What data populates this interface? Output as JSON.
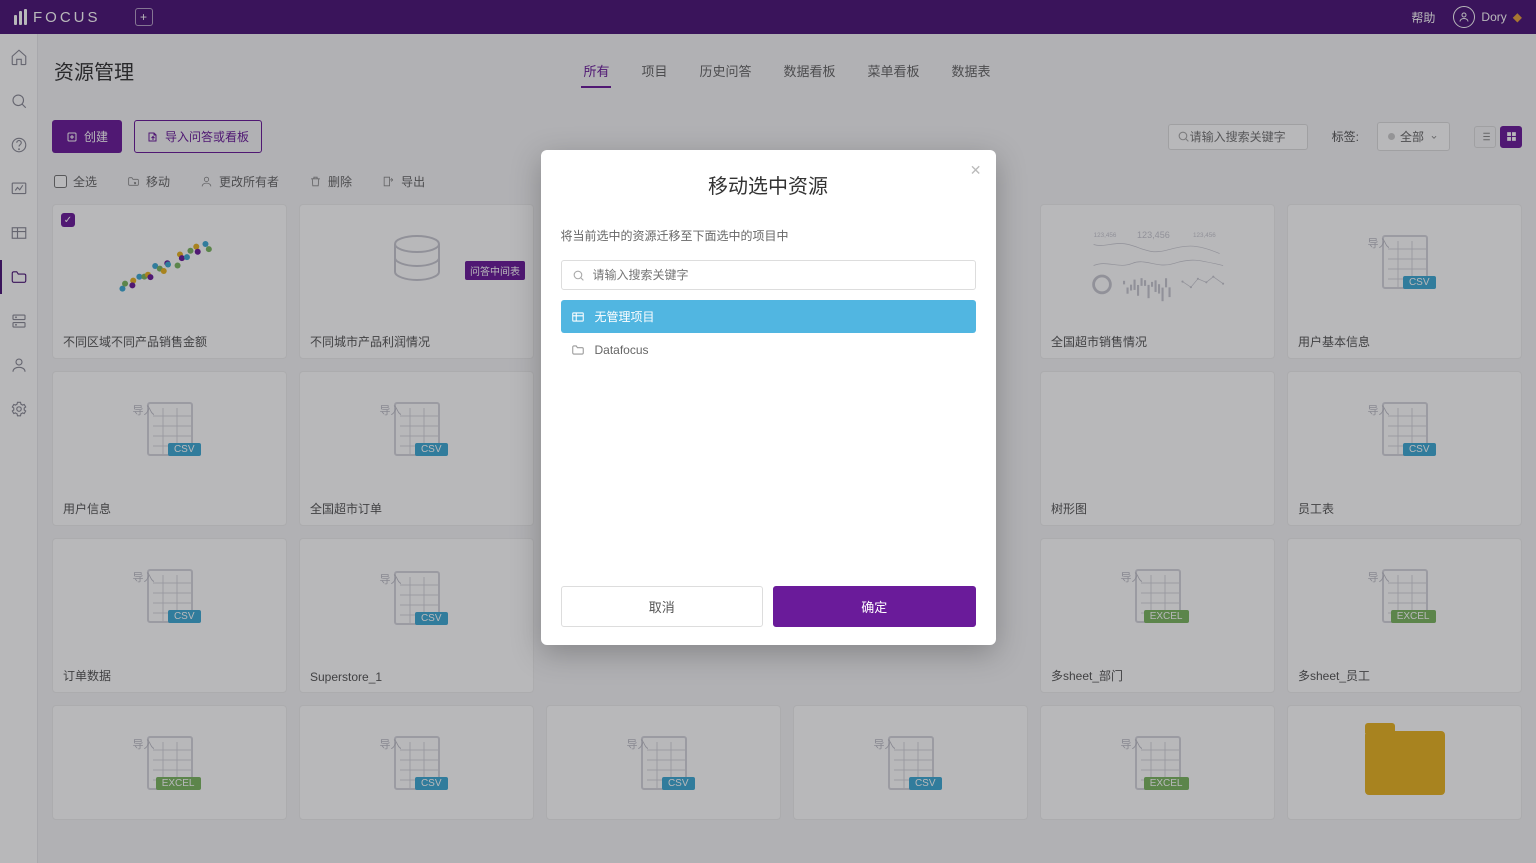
{
  "topbar": {
    "brand": "FOCUS",
    "help": "帮助",
    "user": "Dory"
  },
  "page_title": "资源管理",
  "tabs": [
    {
      "label": "所有",
      "active": true
    },
    {
      "label": "项目"
    },
    {
      "label": "历史问答"
    },
    {
      "label": "数据看板"
    },
    {
      "label": "菜单看板"
    },
    {
      "label": "数据表"
    }
  ],
  "toolbar": {
    "create": "创建",
    "import": "导入问答或看板",
    "search_placeholder": "请输入搜索关键字",
    "tags_label": "标签:",
    "tags_all": "全部"
  },
  "actions": {
    "select_all": "全选",
    "move": "移动",
    "change_owner": "更改所有者",
    "delete": "删除",
    "export": "导出"
  },
  "cards": [
    {
      "title": "不同区域不同产品销售金额",
      "type": "scatter",
      "checked": true
    },
    {
      "title": "不同城市产品利润情况",
      "type": "db",
      "badge": "问答中间表"
    },
    {
      "title": "",
      "type": "hidden"
    },
    {
      "title": "",
      "type": "hidden"
    },
    {
      "title": "全国超市销售情况",
      "type": "dash"
    },
    {
      "title": "用户基本信息",
      "type": "csv",
      "fmt": "CSV"
    },
    {
      "title": "用户信息",
      "type": "csv",
      "fmt": "CSV"
    },
    {
      "title": "全国超市订单",
      "type": "csv",
      "fmt": "CSV"
    },
    {
      "title": "",
      "type": "hidden"
    },
    {
      "title": "",
      "type": "hidden"
    },
    {
      "title": "树形图",
      "type": "tree"
    },
    {
      "title": "员工表",
      "type": "csv",
      "fmt": "CSV"
    },
    {
      "title": "订单数据",
      "type": "csv",
      "fmt": "CSV"
    },
    {
      "title": "Superstore_1",
      "type": "csv",
      "fmt": "CSV"
    },
    {
      "title": "",
      "type": "hidden"
    },
    {
      "title": "",
      "type": "hidden"
    },
    {
      "title": "多sheet_部门",
      "type": "csv",
      "fmt": "EXCEL"
    },
    {
      "title": "多sheet_员工",
      "type": "csv",
      "fmt": "EXCEL"
    },
    {
      "title": "",
      "type": "csv",
      "fmt": "EXCEL",
      "partial": true
    },
    {
      "title": "",
      "type": "csv",
      "fmt": "CSV",
      "partial": true
    },
    {
      "title": "",
      "type": "csv",
      "fmt": "CSV",
      "partial": true
    },
    {
      "title": "",
      "type": "csv",
      "fmt": "CSV",
      "partial": true
    },
    {
      "title": "",
      "type": "csv",
      "fmt": "EXCEL",
      "partial": true
    },
    {
      "title": "",
      "type": "folder",
      "partial": true
    }
  ],
  "modal": {
    "title": "移动选中资源",
    "subtitle": "将当前选中的资源迁移至下面选中的项目中",
    "search_placeholder": "请输入搜索关键字",
    "projects": [
      {
        "name": "无管理项目",
        "selected": true
      },
      {
        "name": "Datafocus",
        "selected": false
      }
    ],
    "cancel": "取消",
    "confirm": "确定"
  },
  "import_label": "导入"
}
